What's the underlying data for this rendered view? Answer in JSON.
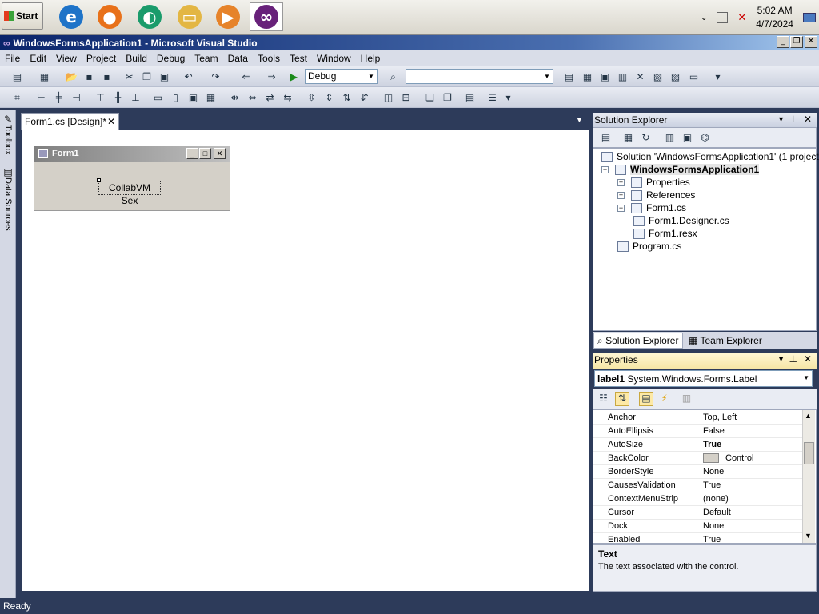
{
  "taskbar": {
    "start_label": "Start",
    "apps": [
      {
        "icon": "internet-explorer-icon",
        "glyph": "e",
        "color": "#1e73c8"
      },
      {
        "icon": "firefox-icon",
        "glyph": "●",
        "color": "#e8711a"
      },
      {
        "icon": "edge-icon",
        "glyph": "◐",
        "color": "#1a9b6b"
      },
      {
        "icon": "file-explorer-icon",
        "glyph": "▭",
        "color": "#e3b643"
      },
      {
        "icon": "media-player-icon",
        "glyph": "▶",
        "color": "#e6832a"
      },
      {
        "icon": "visual-studio-icon",
        "glyph": "∞",
        "color": "#68217a"
      }
    ],
    "clock_time": "5:02 AM",
    "clock_date": "4/7/2024"
  },
  "window": {
    "title": "WindowsFormsApplication1 - Microsoft Visual Studio"
  },
  "menu": [
    "File",
    "Edit",
    "View",
    "Project",
    "Build",
    "Debug",
    "Team",
    "Data",
    "Tools",
    "Test",
    "Window",
    "Help"
  ],
  "toolbar": {
    "config": "Debug",
    "find_value": ""
  },
  "left_tabs": {
    "toolbox": "Toolbox",
    "datasources": "Data Sources"
  },
  "document": {
    "tab_label": "Form1.cs [Design]*",
    "form_title": "Form1",
    "label_text": "CollabVM Sex"
  },
  "solution_explorer": {
    "title": "Solution Explorer",
    "items": [
      {
        "label": "Solution 'WindowsFormsApplication1' (1 project)",
        "expander": ""
      },
      {
        "label": "WindowsFormsApplication1",
        "expander": "−"
      },
      {
        "label": "Properties",
        "expander": "+"
      },
      {
        "label": "References",
        "expander": "+"
      },
      {
        "label": "Form1.cs",
        "expander": "−"
      },
      {
        "label": "Form1.Designer.cs",
        "expander": ""
      },
      {
        "label": "Form1.resx",
        "expander": ""
      },
      {
        "label": "Program.cs",
        "expander": ""
      }
    ],
    "tab_solution": "Solution Explorer",
    "tab_team": "Team Explorer"
  },
  "properties": {
    "title": "Properties",
    "object_name": "label1",
    "object_type": "System.Windows.Forms.Label",
    "rows": [
      {
        "name": "Anchor",
        "value": "Top, Left"
      },
      {
        "name": "AutoEllipsis",
        "value": "False"
      },
      {
        "name": "AutoSize",
        "value": "True"
      },
      {
        "name": "BackColor",
        "value": "Control"
      },
      {
        "name": "BorderStyle",
        "value": "None"
      },
      {
        "name": "CausesValidation",
        "value": "True"
      },
      {
        "name": "ContextMenuStrip",
        "value": "(none)"
      },
      {
        "name": "Cursor",
        "value": "Default"
      },
      {
        "name": "Dock",
        "value": "None"
      },
      {
        "name": "Enabled",
        "value": "True"
      }
    ],
    "desc_title": "Text",
    "desc_text": "The text associated with the control."
  },
  "status": "Ready"
}
